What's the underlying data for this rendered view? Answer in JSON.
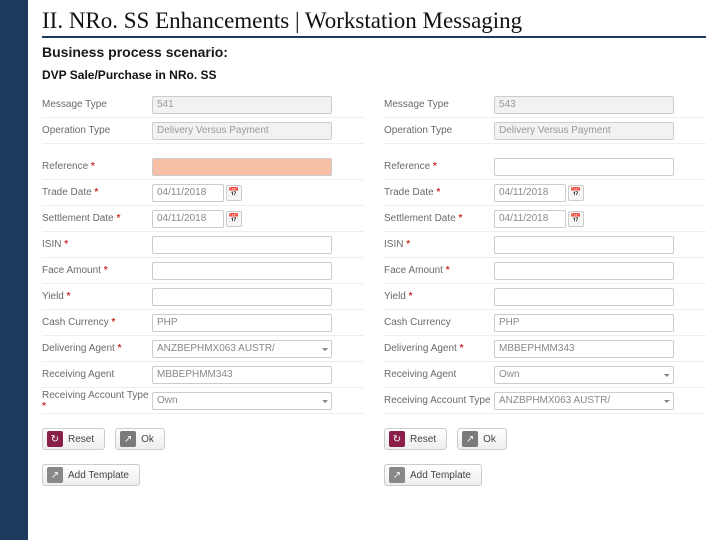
{
  "header": {
    "title": "II. NRo. SS Enhancements | Workstation Messaging",
    "subtitle": "Business process scenario:",
    "scenario": "DVP Sale/Purchase in NRo. SS"
  },
  "labels": {
    "message_type": "Message Type",
    "operation_type": "Operation Type",
    "reference": "Reference",
    "trade_date": "Trade Date",
    "settlement_date": "Settlement Date",
    "isin": "ISIN",
    "face_amount": "Face Amount",
    "yield": "Yield",
    "cash_currency": "Cash Currency",
    "delivering_agent": "Delivering Agent",
    "receiving_agent": "Receiving Agent",
    "receiving_account_type": "Receiving Account Type"
  },
  "buttons": {
    "reset": "Reset",
    "ok": "Ok",
    "add_template": "Add Template"
  },
  "icons": {
    "reset": "↻",
    "ok": "↗",
    "tmpl": "↗",
    "cal": "📅"
  },
  "left_form": {
    "message_type": "541",
    "operation_type": "Delivery Versus Payment",
    "reference": "",
    "trade_date": "04/11/2018",
    "settlement_date": "04/11/2018",
    "isin": "",
    "face_amount": "",
    "yield": "",
    "cash_currency": "PHP",
    "delivering_agent": "ANZBEPHMX063 AUSTR/",
    "receiving_agent": "MBBEPHMM343",
    "receiving_account_type": "Own"
  },
  "right_form": {
    "message_type": "543",
    "operation_type": "Delivery Versus Payment",
    "reference": "",
    "trade_date": "04/11/2018",
    "settlement_date": "04/11/2018",
    "isin": "",
    "face_amount": "",
    "yield": "",
    "cash_currency": "PHP",
    "delivering_agent": "MBBEPHMM343",
    "receiving_agent": "Own",
    "receiving_account_type": "ANZBPHMX063 AUSTR/"
  }
}
